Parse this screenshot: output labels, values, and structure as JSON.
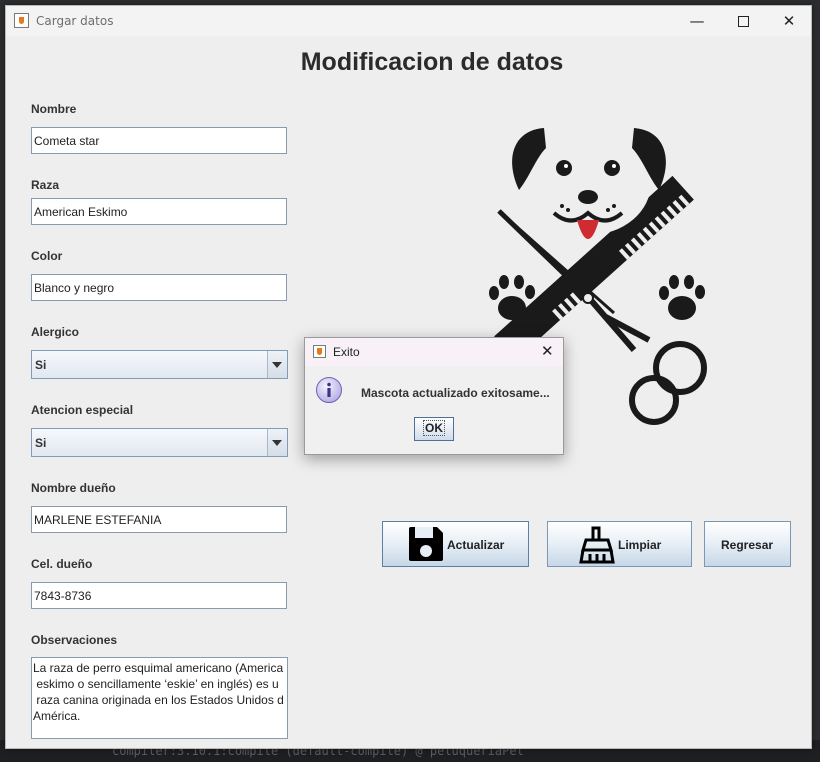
{
  "background": {
    "ide_text": "compiler:3.10.1:compile (default-compile) @ peluqueriaPet"
  },
  "window": {
    "title": "Cargar datos"
  },
  "page": {
    "heading": "Modificacion de datos"
  },
  "form": {
    "nombre": {
      "label": "Nombre",
      "value": "Cometa star"
    },
    "raza": {
      "label": "Raza",
      "value": "American Eskimo"
    },
    "color": {
      "label": "Color",
      "value": "Blanco y negro"
    },
    "alergico": {
      "label": "Alergico",
      "value": "Si"
    },
    "atencion": {
      "label": "Atencion especial",
      "value": "Si"
    },
    "dueno": {
      "label": "Nombre dueño",
      "value": "MARLENE ESTEFANIA"
    },
    "cel": {
      "label": "Cel. dueño",
      "value": "7843-8736"
    },
    "observaciones": {
      "label": "Observaciones",
      "value": "La raza de perro esquimal americano (America\n eskimo o sencillamente ‘eskie’ en inglés) es u\n raza canina originada en los Estados Unidos d\nAmérica."
    }
  },
  "buttons": {
    "actualizar": "Actualizar",
    "limpiar": "Limpiar",
    "regresar": "Regresar"
  },
  "dialog": {
    "title": "Exito",
    "message": "Mascota actualizado exitosame...",
    "ok": "OK"
  },
  "icons": {
    "window": "java-cup-icon",
    "save": "floppy-disk-icon",
    "clean": "broom-icon",
    "info": "info-icon",
    "logo": "dog-grooming-logo"
  },
  "colors": {
    "window_bg": "#eeeeee",
    "button_border": "#7a97b8",
    "logo_dark": "#1a1a1a",
    "tongue": "#d02b32"
  }
}
